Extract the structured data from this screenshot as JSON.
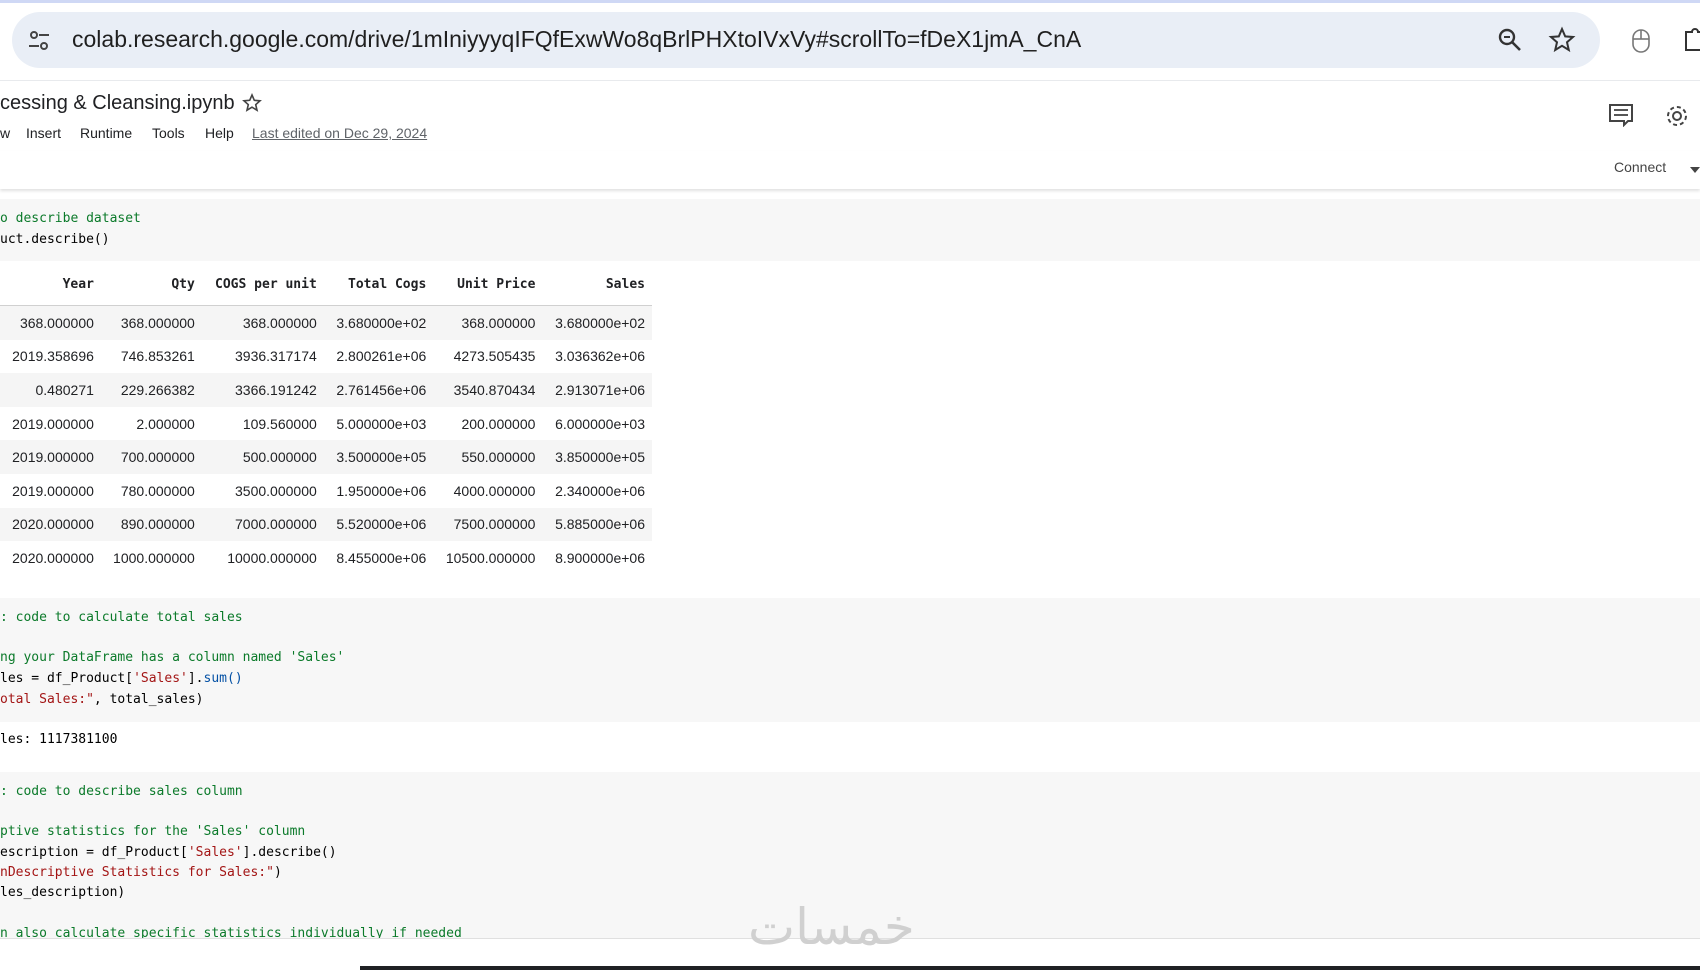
{
  "browser": {
    "url": "colab.research.google.com/drive/1mIniyyyqIFQfExwWo8qBrlPHXtoIVxVy#scrollTo=fDeX1jmA_CnA",
    "icons": [
      "site-info-icon",
      "zoom-icon",
      "bookmark-star-icon",
      "extension-mouse-icon",
      "extension-puzzle-icon"
    ]
  },
  "notebook": {
    "title": "cessing & Cleansing.ipynb",
    "menu": [
      "w",
      "Insert",
      "Runtime",
      "Tools",
      "Help"
    ],
    "last_edited": "Last edited on Dec 29, 2024",
    "connect_label": "Connect"
  },
  "cells": {
    "describe_code": {
      "comment": "o describe dataset",
      "line2": "uct.describe()"
    },
    "describe_output": {
      "columns": [
        "Year",
        "Qty",
        "COGS per unit",
        "Total Cogs",
        "Unit Price",
        "Sales"
      ],
      "rows": [
        [
          "368.000000",
          "368.000000",
          "368.000000",
          "3.680000e+02",
          "368.000000",
          "3.680000e+02"
        ],
        [
          "2019.358696",
          "746.853261",
          "3936.317174",
          "2.800261e+06",
          "4273.505435",
          "3.036362e+06"
        ],
        [
          "0.480271",
          "229.266382",
          "3366.191242",
          "2.761456e+06",
          "3540.870434",
          "2.913071e+06"
        ],
        [
          "2019.000000",
          "2.000000",
          "109.560000",
          "5.000000e+03",
          "200.000000",
          "6.000000e+03"
        ],
        [
          "2019.000000",
          "700.000000",
          "500.000000",
          "3.500000e+05",
          "550.000000",
          "3.850000e+05"
        ],
        [
          "2019.000000",
          "780.000000",
          "3500.000000",
          "1.950000e+06",
          "4000.000000",
          "2.340000e+06"
        ],
        [
          "2020.000000",
          "890.000000",
          "7000.000000",
          "5.520000e+06",
          "7500.000000",
          "5.885000e+06"
        ],
        [
          "2020.000000",
          "1000.000000",
          "10000.000000",
          "8.455000e+06",
          "10500.000000",
          "8.900000e+06"
        ]
      ]
    },
    "total_sales_code": {
      "comment1": ": code to calculate total sales",
      "comment2": "ng your DataFrame has a column named 'Sales'",
      "line3_a": "les = df_Product[",
      "line3_str": "'Sales'",
      "line3_b": "].",
      "line3_fn": "sum",
      "line3_c": "()",
      "line4_str": "otal Sales:\"",
      "line4_b": ", total_sales)"
    },
    "total_sales_output": "les: 1117381100",
    "describe_sales_code": {
      "comment1": ": code to describe sales column",
      "comment2": "ptive statistics for the 'Sales' column",
      "line3_a": "escription = df_Product[",
      "line3_str": "'Sales'",
      "line3_b": "].describe()",
      "line4_str": "nDescriptive Statistics for Sales:\"",
      "line4_b": ")",
      "line5": "les_description)",
      "line6": "n also calculate specific statistics individually if needed"
    }
  },
  "watermark": "خمسات"
}
